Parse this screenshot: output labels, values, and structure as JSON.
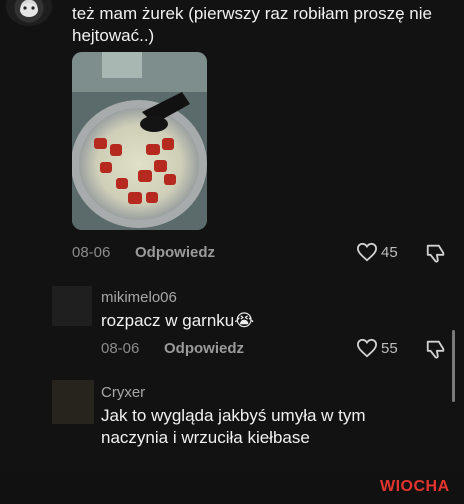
{
  "comments": [
    {
      "text": "też mam żurek (pierwszy raz robiłam proszę nie hejtować..)",
      "date": "08-06",
      "reply_label": "Odpowiedz",
      "likes": "45"
    },
    {
      "username": "mikimelo06",
      "text": "rozpacz w garnku😭",
      "date": "08-06",
      "reply_label": "Odpowiedz",
      "likes": "55"
    },
    {
      "username": "Cryxer",
      "text": "Jak to wygląda jakbyś umyła w tym naczynia i wrzuciła kiełbase"
    }
  ],
  "watermark": {
    "brand": "WIOCHA",
    "accent_color": "#e3342f"
  },
  "colors": {
    "background": "#121212",
    "text": "#f1f1f1",
    "muted": "#8b8b8b"
  },
  "icons": [
    "heart-outline-icon",
    "thumbs-down-icon"
  ]
}
